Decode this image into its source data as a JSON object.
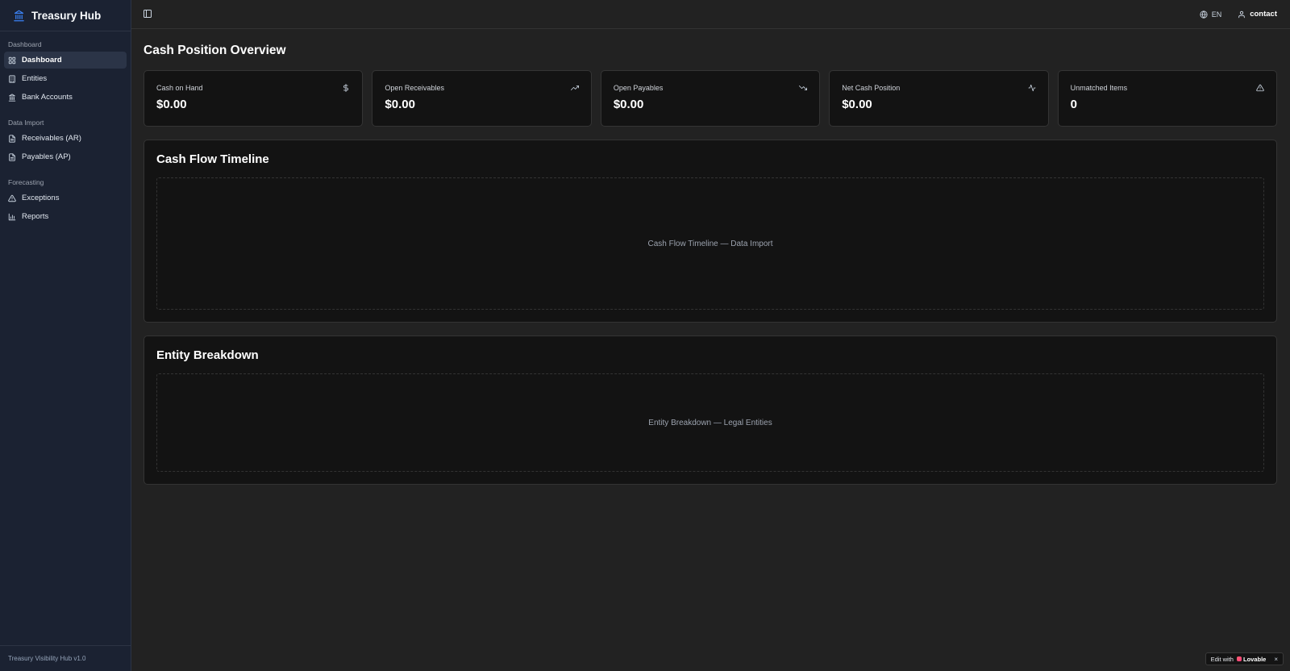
{
  "brand": {
    "name": "Treasury Hub",
    "icon": "landmark-icon",
    "accent": "#3b82f6"
  },
  "sidebar": {
    "groups": [
      {
        "label": "Dashboard",
        "items": [
          {
            "label": "Dashboard",
            "icon": "grid-icon",
            "active": true
          },
          {
            "label": "Entities",
            "icon": "building-icon"
          },
          {
            "label": "Bank Accounts",
            "icon": "landmark-icon"
          }
        ]
      },
      {
        "label": "Data Import",
        "items": [
          {
            "label": "Receivables (AR)",
            "icon": "file-icon"
          },
          {
            "label": "Payables (AP)",
            "icon": "file-icon"
          }
        ]
      },
      {
        "label": "Forecasting",
        "items": [
          {
            "label": "Exceptions",
            "icon": "alert-triangle-icon"
          },
          {
            "label": "Reports",
            "icon": "bar-chart-icon"
          }
        ]
      }
    ],
    "footer": "Treasury Visibility Hub v1.0"
  },
  "topbar": {
    "language": "EN",
    "user": "contact"
  },
  "main": {
    "title": "Cash Position Overview",
    "kpis": [
      {
        "label": "Cash on Hand",
        "value": "$0.00",
        "icon": "dollar-icon"
      },
      {
        "label": "Open Receivables",
        "value": "$0.00",
        "icon": "trending-up-icon"
      },
      {
        "label": "Open Payables",
        "value": "$0.00",
        "icon": "trending-down-icon"
      },
      {
        "label": "Net Cash Position",
        "value": "$0.00",
        "icon": "activity-icon"
      },
      {
        "label": "Unmatched Items",
        "value": "0",
        "icon": "alert-triangle-icon"
      }
    ],
    "panels": [
      {
        "title": "Cash Flow Timeline",
        "placeholder": "Cash Flow Timeline — Data Import"
      },
      {
        "title": "Entity Breakdown",
        "placeholder": "Entity Breakdown — Legal Entities"
      }
    ]
  },
  "badge": {
    "prefix": "Edit with",
    "brand": "Lovable",
    "close": "×"
  }
}
